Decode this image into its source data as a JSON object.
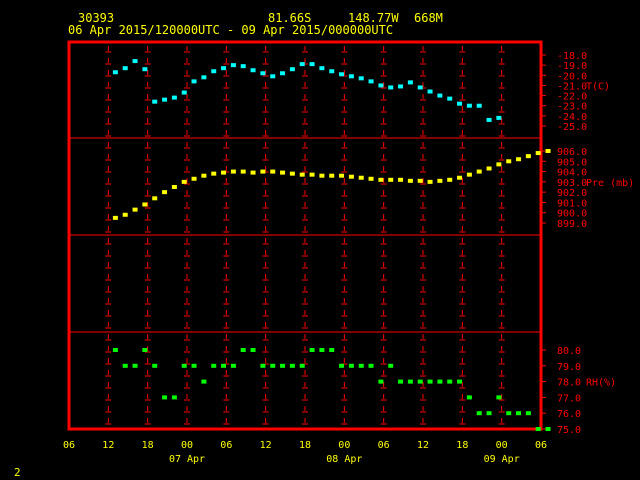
{
  "header": {
    "station": "30393",
    "lat": "81.66S",
    "lon": "148.77W",
    "elev": "668M",
    "period": "06 Apr 2015/120000UTC - 09 Apr 2015/000000UTC"
  },
  "page_number": "2",
  "colors": {
    "frame": "#ff0000",
    "axis_text": "#ff0000",
    "time_text": "#ffff00",
    "temp": "#00ffff",
    "pressure": "#ffff00",
    "rh": "#00ff00"
  },
  "chart_data": {
    "type": "scatter",
    "x_axis": {
      "unit": "hours since 06 Apr 00UTC (axis shows UTC hour)",
      "range": [
        6,
        78
      ],
      "tick_values": [
        6,
        12,
        18,
        24,
        30,
        36,
        42,
        48,
        54,
        60,
        66,
        72,
        78
      ],
      "tick_labels": [
        "06",
        "12",
        "18",
        "00",
        "06",
        "12",
        "18",
        "00",
        "06",
        "12",
        "18",
        "00",
        "06"
      ],
      "date_labels": [
        {
          "x": 24,
          "label": "07 Apr"
        },
        {
          "x": 48,
          "label": "08 Apr"
        },
        {
          "x": 72,
          "label": "09 Apr"
        }
      ]
    },
    "panels": [
      {
        "name": "temperature",
        "label": "T(C)",
        "ylim": [
          -25,
          -18
        ],
        "tick_values": [
          -18,
          -19,
          -20,
          -21,
          -22,
          -23,
          -24,
          -25
        ],
        "tick_labels": [
          "-18.0",
          "-19.0",
          "-20.0",
          "-21.0",
          "-22.0",
          "-23.0",
          "-24.0",
          "-25.0"
        ],
        "points": [
          [
            13,
            -19.7
          ],
          [
            14.5,
            -19.3
          ],
          [
            16,
            -18.6
          ],
          [
            17.5,
            -19.4
          ],
          [
            19,
            -22.6
          ],
          [
            20.5,
            -22.4
          ],
          [
            22,
            -22.2
          ],
          [
            23.5,
            -21.7
          ],
          [
            25,
            -20.6
          ],
          [
            26.5,
            -20.2
          ],
          [
            28,
            -19.6
          ],
          [
            29.5,
            -19.3
          ],
          [
            31,
            -19.0
          ],
          [
            32.5,
            -19.1
          ],
          [
            34,
            -19.5
          ],
          [
            35.5,
            -19.8
          ],
          [
            37,
            -20.1
          ],
          [
            38.5,
            -19.8
          ],
          [
            40,
            -19.4
          ],
          [
            41.5,
            -18.9
          ],
          [
            43,
            -18.9
          ],
          [
            44.5,
            -19.3
          ],
          [
            46,
            -19.6
          ],
          [
            47.5,
            -19.9
          ],
          [
            49,
            -20.1
          ],
          [
            50.5,
            -20.3
          ],
          [
            52,
            -20.6
          ],
          [
            53.5,
            -21.0
          ],
          [
            55,
            -21.2
          ],
          [
            56.5,
            -21.1
          ],
          [
            58,
            -20.7
          ],
          [
            59.5,
            -21.2
          ],
          [
            61,
            -21.6
          ],
          [
            62.5,
            -22.0
          ],
          [
            64,
            -22.3
          ],
          [
            65.5,
            -22.8
          ],
          [
            67,
            -23.0
          ],
          [
            68.5,
            -23.0
          ],
          [
            70,
            -24.4
          ],
          [
            71.5,
            -24.2
          ]
        ]
      },
      {
        "name": "pressure",
        "label": "Pre (mb)",
        "ylim": [
          899,
          906
        ],
        "tick_values": [
          906,
          905,
          904,
          903,
          902,
          901,
          900,
          899
        ],
        "tick_labels": [
          "906.0",
          "905.0",
          "904.0",
          "903.0",
          "902.0",
          "901.0",
          "900.0",
          "899.0"
        ],
        "points": [
          [
            13,
            899.5
          ],
          [
            14.5,
            899.8
          ],
          [
            16,
            900.3
          ],
          [
            17.5,
            900.8
          ],
          [
            19,
            901.4
          ],
          [
            20.5,
            902.0
          ],
          [
            22,
            902.5
          ],
          [
            23.5,
            903.0
          ],
          [
            25,
            903.3
          ],
          [
            26.5,
            903.6
          ],
          [
            28,
            903.8
          ],
          [
            29.5,
            903.9
          ],
          [
            31,
            904.0
          ],
          [
            32.5,
            904.0
          ],
          [
            34,
            903.9
          ],
          [
            35.5,
            904.0
          ],
          [
            37,
            904.0
          ],
          [
            38.5,
            903.9
          ],
          [
            40,
            903.8
          ],
          [
            41.5,
            903.7
          ],
          [
            43,
            903.7
          ],
          [
            44.5,
            903.6
          ],
          [
            46,
            903.6
          ],
          [
            47.5,
            903.6
          ],
          [
            49,
            903.5
          ],
          [
            50.5,
            903.4
          ],
          [
            52,
            903.3
          ],
          [
            53.5,
            903.2
          ],
          [
            55,
            903.2
          ],
          [
            56.5,
            903.2
          ],
          [
            58,
            903.1
          ],
          [
            59.5,
            903.1
          ],
          [
            61,
            903.0
          ],
          [
            62.5,
            903.1
          ],
          [
            64,
            903.2
          ],
          [
            65.5,
            903.4
          ],
          [
            67,
            903.7
          ],
          [
            68.5,
            904.0
          ],
          [
            70,
            904.3
          ],
          [
            71.5,
            904.7
          ],
          [
            73,
            905.0
          ],
          [
            74.5,
            905.2
          ],
          [
            76,
            905.5
          ],
          [
            77.5,
            905.8
          ],
          [
            79,
            906.0
          ]
        ]
      },
      {
        "name": "relative_humidity",
        "label": "RH(%)",
        "ylim": [
          75,
          80
        ],
        "tick_values": [
          80,
          79,
          78,
          77,
          76,
          75
        ],
        "tick_labels": [
          "80.0",
          "79.0",
          "78.0",
          "77.0",
          "76.0",
          "75.0"
        ],
        "points": [
          [
            13,
            80
          ],
          [
            14.5,
            79
          ],
          [
            16,
            79
          ],
          [
            17.5,
            80
          ],
          [
            19,
            79
          ],
          [
            20.5,
            77
          ],
          [
            22,
            77
          ],
          [
            23.5,
            79
          ],
          [
            25,
            79
          ],
          [
            26.5,
            78
          ],
          [
            28,
            79
          ],
          [
            29.5,
            79
          ],
          [
            31,
            79
          ],
          [
            32.5,
            80
          ],
          [
            34,
            80
          ],
          [
            35.5,
            79
          ],
          [
            37,
            79
          ],
          [
            38.5,
            79
          ],
          [
            40,
            79
          ],
          [
            41.5,
            79
          ],
          [
            43,
            80
          ],
          [
            44.5,
            80
          ],
          [
            46,
            80
          ],
          [
            47.5,
            79
          ],
          [
            49,
            79
          ],
          [
            50.5,
            79
          ],
          [
            52,
            79
          ],
          [
            53.5,
            78
          ],
          [
            55,
            79
          ],
          [
            56.5,
            78
          ],
          [
            58,
            78
          ],
          [
            59.5,
            78
          ],
          [
            61,
            78
          ],
          [
            62.5,
            78
          ],
          [
            64,
            78
          ],
          [
            65.5,
            78
          ],
          [
            67,
            77
          ],
          [
            68.5,
            76
          ],
          [
            70,
            76
          ],
          [
            71.5,
            77
          ],
          [
            73,
            76
          ],
          [
            74.5,
            76
          ],
          [
            76,
            76
          ],
          [
            77.5,
            75
          ],
          [
            79,
            75
          ]
        ]
      }
    ]
  }
}
